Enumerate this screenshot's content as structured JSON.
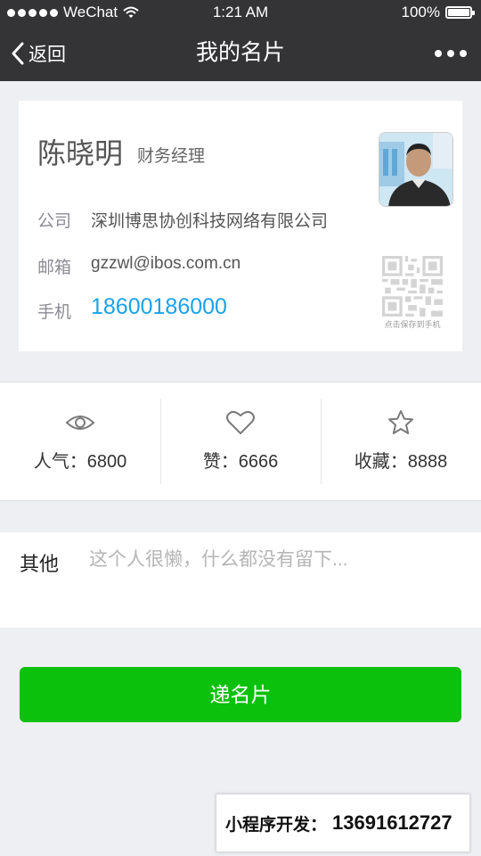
{
  "statusbar": {
    "carrier": "WeChat",
    "time": "1:21 AM",
    "battery": "100%",
    "battery_level": 1.0
  },
  "navbar": {
    "back_label": "返回",
    "title": "我的名片"
  },
  "card": {
    "name": "陈晓明",
    "position": "财务经理",
    "company_label": "公司",
    "company": "深圳博思协创科技网络有限公司",
    "email_label": "邮箱",
    "email": "gzzwl@ibos.com.cn",
    "phone_label": "手机",
    "phone": "18600186000",
    "qr_caption": "点击保存到手机",
    "phone_color": "#19a2ea"
  },
  "stats": [
    {
      "icon": "eye-icon",
      "text": "人气：6800"
    },
    {
      "icon": "heart-icon",
      "text": "赞：6666"
    },
    {
      "icon": "star-icon",
      "text": "收藏：8888"
    }
  ],
  "other": {
    "label": "其他",
    "value": "",
    "placeholder": "这个人很懒，什么都没有留下..."
  },
  "send_button": {
    "label": "递名片",
    "color": "#0bc10b"
  },
  "promo": {
    "label": "小程序开发：",
    "number": "13691612727"
  }
}
